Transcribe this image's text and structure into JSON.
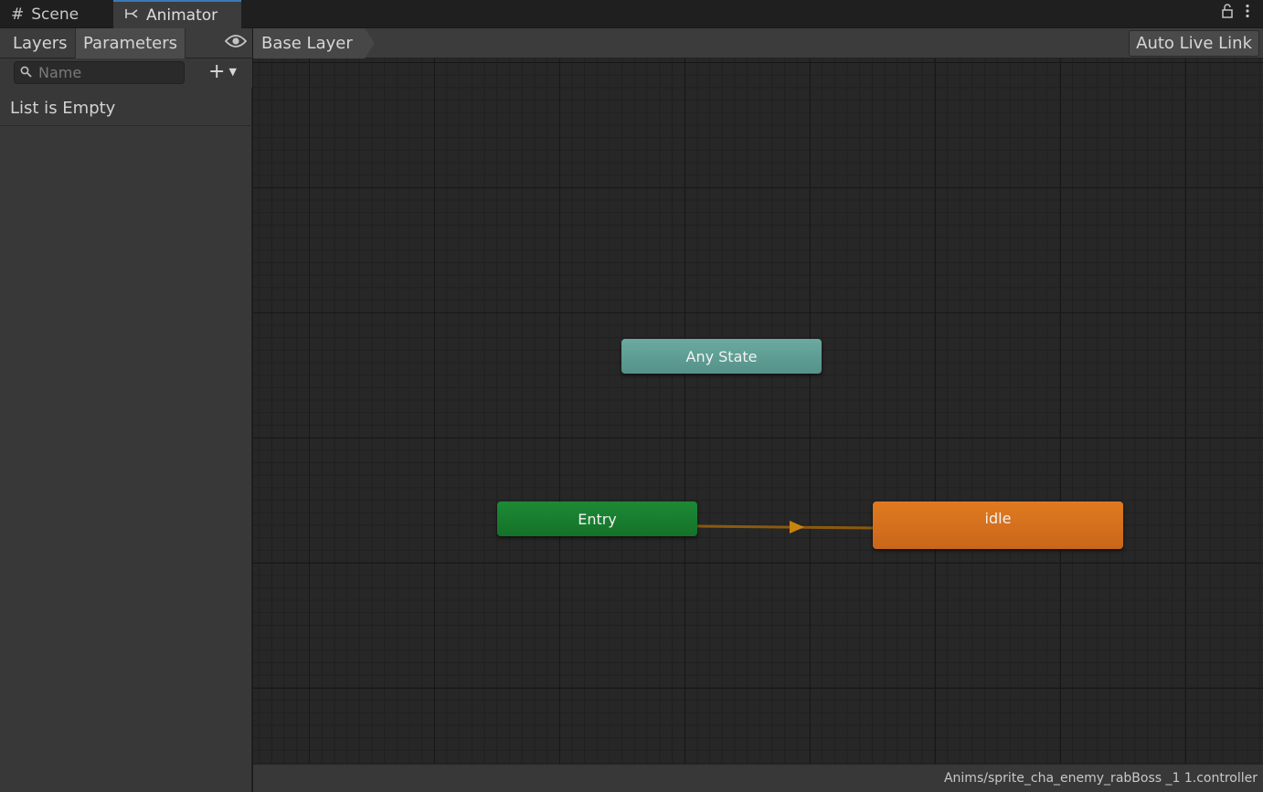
{
  "window": {
    "tabs": [
      {
        "label": "Scene",
        "icon": "grid-icon"
      },
      {
        "label": "Animator",
        "icon": "animator-icon"
      }
    ],
    "lock_icon": "lock-icon",
    "menu_icon": "kebab-menu-icon"
  },
  "left_panel": {
    "tabs": [
      {
        "label": "Layers"
      },
      {
        "label": "Parameters"
      }
    ],
    "active_tab": "Parameters",
    "eye_icon": "eye-icon",
    "search": {
      "placeholder": "Name",
      "value": ""
    },
    "add_icon": "plus-icon",
    "empty_text": "List is Empty"
  },
  "breadcrumb": {
    "label": "Base Layer"
  },
  "toolbar": {
    "auto_live_link": "Auto Live Link"
  },
  "graph": {
    "nodes": [
      {
        "id": "any",
        "label": "Any State",
        "color": "#62a095"
      },
      {
        "id": "entry",
        "label": "Entry",
        "color": "#1a7f31"
      },
      {
        "id": "idle",
        "label": "idle",
        "color": "#d8721d"
      }
    ],
    "transitions": [
      {
        "from": "Entry",
        "to": "idle",
        "color": "#b07612"
      }
    ]
  },
  "status": {
    "file_path": "Anims/sprite_cha_enemy_rabBoss _1 1.controller"
  }
}
